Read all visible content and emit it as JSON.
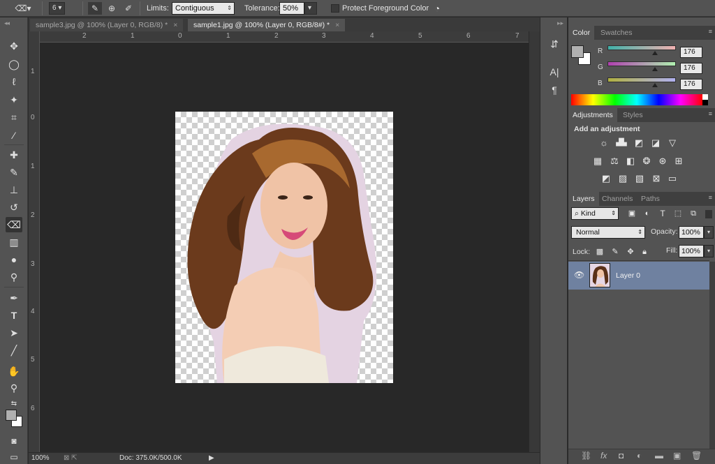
{
  "options_bar": {
    "brush_size": "6",
    "limits_label": "Limits:",
    "limits_value": "Contiguous",
    "tolerance_label": "Tolerance:",
    "tolerance_value": "50%",
    "protect_fg_label": "Protect Foreground Color"
  },
  "tabs": [
    {
      "label": "sample3.jpg @ 100% (Layer 0, RGB/8) *",
      "close": "×"
    },
    {
      "label": "sample1.jpg @ 100% (Layer 0, RGB/8#) *",
      "close": "×"
    }
  ],
  "ruler": {
    "h": [
      "2",
      "1",
      "0",
      "1",
      "2",
      "3",
      "4",
      "5",
      "6",
      "7"
    ],
    "v": [
      "1",
      "0",
      "1",
      "2",
      "3",
      "4",
      "5",
      "6"
    ]
  },
  "status": {
    "zoom": "100%",
    "doc": "Doc: 375.0K/500.0K"
  },
  "color_panel": {
    "tabs": [
      "Color",
      "Swatches"
    ],
    "channels": [
      {
        "name": "R",
        "value": "176",
        "level": 0.69
      },
      {
        "name": "G",
        "value": "176",
        "level": 0.69
      },
      {
        "name": "B",
        "value": "176",
        "level": 0.69
      }
    ],
    "fg_color": "#b0b0b0",
    "bg_color": "#ffffff"
  },
  "adjustments_panel": {
    "tabs": [
      "Adjustments",
      "Styles"
    ],
    "heading": "Add an adjustment"
  },
  "layers_panel": {
    "tabs": [
      "Layers",
      "Channels",
      "Paths"
    ],
    "filter_kind": "Kind",
    "blend_mode": "Normal",
    "opacity_label": "Opacity:",
    "opacity_value": "100%",
    "lock_label": "Lock:",
    "fill_label": "Fill:",
    "fill_value": "100%",
    "layers": [
      {
        "name": "Layer 0",
        "visible": true,
        "selected": true
      }
    ],
    "selected_color": "#6f81a0"
  },
  "icons": {
    "bottom_buttons": [
      "link-icon",
      "fx-icon",
      "mask-icon",
      "adjustment-layer-icon",
      "group-icon",
      "new-layer-icon",
      "trash-icon"
    ]
  }
}
